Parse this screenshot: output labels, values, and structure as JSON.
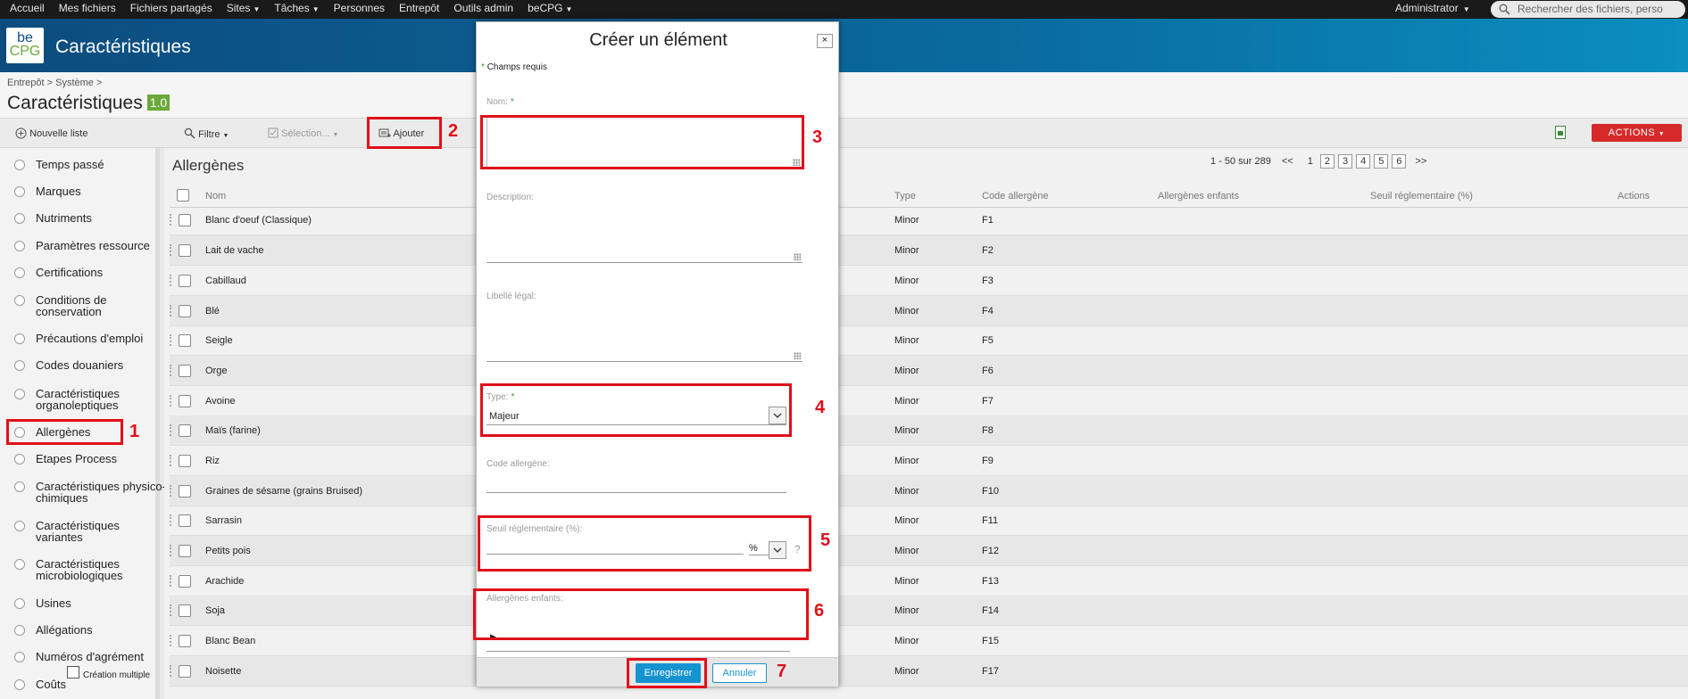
{
  "topnav": {
    "items": [
      "Accueil",
      "Mes fichiers",
      "Fichiers partagés",
      "Sites",
      "Tâches",
      "Personnes",
      "Entrepôt",
      "Outils admin",
      "beCPG"
    ],
    "user": "Administrator",
    "search_placeholder": "Rechercher des fichiers, perso"
  },
  "header": {
    "logo_line1": "be",
    "logo_line2": "CPG",
    "title": "Caractéristiques"
  },
  "breadcrumb": "Entrepôt  >  Système  >",
  "page": {
    "title": "Caractéristiques",
    "version": "1.0"
  },
  "toolbar": {
    "nouvelle_liste": "Nouvelle liste",
    "filtre": "Filtre",
    "selection": "Sélection...",
    "ajouter": "Ajouter",
    "actions": "ACTIONS"
  },
  "sidebar": {
    "items": [
      {
        "label": "Temps passé"
      },
      {
        "label": "Marques"
      },
      {
        "label": "Nutriments"
      },
      {
        "label": "Paramètres ressource"
      },
      {
        "label": "Certifications"
      },
      {
        "label": "Conditions de conservation"
      },
      {
        "label": "Précautions d'emploi"
      },
      {
        "label": "Codes douaniers"
      },
      {
        "label": "Caractéristiques organoleptiques"
      },
      {
        "label": "Allergènes"
      },
      {
        "label": "Etapes Process"
      },
      {
        "label": "Caractéristiques physico-chimiques"
      },
      {
        "label": "Caractéristiques variantes"
      },
      {
        "label": "Caractéristiques microbiologiques"
      },
      {
        "label": "Usines"
      },
      {
        "label": "Allégations"
      },
      {
        "label": "Numéros d'agrément"
      },
      {
        "label": "Coûts"
      }
    ]
  },
  "list": {
    "title": "Allergènes",
    "pager": {
      "range": "1 - 50 sur 289",
      "first": "<<",
      "pages": [
        "1",
        "2",
        "3",
        "4",
        "5",
        "6"
      ],
      "next": ">>"
    },
    "columns": {
      "nom": "Nom",
      "type": "Type",
      "code": "Code allergène",
      "enfants": "Allergènes enfants",
      "seuil": "Seuil réglementaire (%)",
      "actions": "Actions"
    },
    "rows": [
      {
        "nom": "Blanc d'oeuf (Classique)",
        "type": "Minor",
        "code": "F1"
      },
      {
        "nom": "Lait de vache",
        "type": "Minor",
        "code": "F2"
      },
      {
        "nom": "Cabillaud",
        "type": "Minor",
        "code": "F3"
      },
      {
        "nom": "Blé",
        "type": "Minor",
        "code": "F4"
      },
      {
        "nom": "Seigle",
        "type": "Minor",
        "code": "F5"
      },
      {
        "nom": "Orge",
        "type": "Minor",
        "code": "F6"
      },
      {
        "nom": "Avoine",
        "type": "Minor",
        "code": "F7"
      },
      {
        "nom": "Maïs (farine)",
        "type": "Minor",
        "code": "F8"
      },
      {
        "nom": "Riz",
        "type": "Minor",
        "code": "F9"
      },
      {
        "nom": "Graines de sésame (grains Bruised)",
        "type": "Minor",
        "code": "F10"
      },
      {
        "nom": "Sarrasin",
        "type": "Minor",
        "code": "F11"
      },
      {
        "nom": "Petits pois",
        "type": "Minor",
        "code": "F12"
      },
      {
        "nom": "Arachide",
        "type": "Minor",
        "code": "F13"
      },
      {
        "nom": "Soja",
        "type": "Minor",
        "code": "F14"
      },
      {
        "nom": "Blanc Bean",
        "type": "Minor",
        "code": "F15"
      },
      {
        "nom": "Noisette",
        "type": "Minor",
        "code": "F17"
      }
    ]
  },
  "modal": {
    "title": "Créer un élément",
    "close": "×",
    "required_note": "Champs requis",
    "required_star": "*",
    "fields": {
      "nom": "Nom:",
      "description": "Description:",
      "libelle": "Libellé légal:",
      "type": "Type:",
      "type_value": "Majeur",
      "code": "Code allergène:",
      "seuil": "Seuil réglementaire (%):",
      "seuil_unit": "%",
      "help": "?",
      "enfants": "Allergènes enfants:"
    },
    "multi_label": "Création multiple",
    "save": "Enregistrer",
    "cancel": "Annuler"
  },
  "annotations": [
    "1",
    "2",
    "3",
    "4",
    "5",
    "6",
    "7"
  ],
  "colors": {
    "accent": "#1593d0",
    "actions": "#d62a2a",
    "annotation": "#e0101a",
    "version_badge": "#6aa83a"
  }
}
